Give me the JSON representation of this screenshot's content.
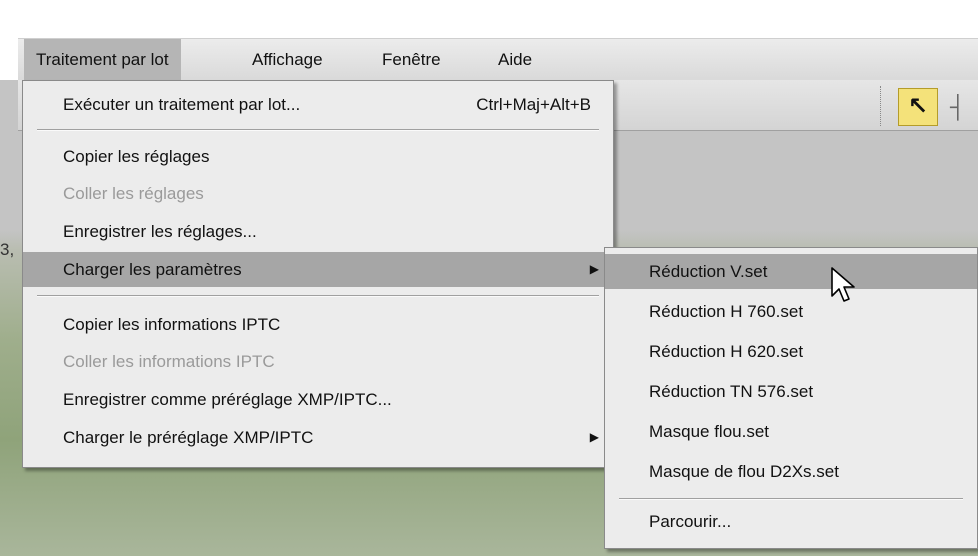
{
  "menubar": {
    "items": [
      {
        "label": "Traitement par lot",
        "active": true
      },
      {
        "label": "Affichage",
        "active": false
      },
      {
        "label": "Fenêtre",
        "active": false
      },
      {
        "label": "Aide",
        "active": false
      }
    ]
  },
  "side_label": "3,",
  "batch_menu": {
    "items": [
      {
        "label": "Exécuter un traitement par lot...",
        "shortcut": "Ctrl+Maj+Alt+B",
        "enabled": true
      },
      {
        "label": "Copier les réglages",
        "enabled": true
      },
      {
        "label": "Coller les réglages",
        "enabled": false
      },
      {
        "label": "Enregistrer les réglages...",
        "enabled": true
      },
      {
        "label": "Charger les paramètres",
        "enabled": true,
        "submenu": true,
        "highlighted": true
      },
      {
        "label": "Copier les informations IPTC",
        "enabled": true
      },
      {
        "label": "Coller les informations IPTC",
        "enabled": false
      },
      {
        "label": "Enregistrer comme préréglage XMP/IPTC...",
        "enabled": true
      },
      {
        "label": "Charger le préréglage XMP/IPTC",
        "enabled": true,
        "submenu": true
      }
    ]
  },
  "settings_submenu": {
    "items": [
      {
        "label": "Réduction V.set",
        "highlighted": true
      },
      {
        "label": "Réduction H 760.set"
      },
      {
        "label": "Réduction H 620.set"
      },
      {
        "label": "Réduction TN 576.set"
      },
      {
        "label": "Masque flou.set"
      },
      {
        "label": "Masque de flou D2Xs.set"
      },
      {
        "label": "Parcourir..."
      }
    ]
  },
  "icons": {
    "submenu_arrow": "chevron-right-icon",
    "toolbar_arrow": "selection-arrow-icon",
    "cursor": "mouse-pointer-icon"
  },
  "colors": {
    "menu_bg": "#ececec",
    "highlight": "#a6a6a6",
    "disabled_text": "#9a9a9a",
    "tool_active": "#f4e27a"
  }
}
